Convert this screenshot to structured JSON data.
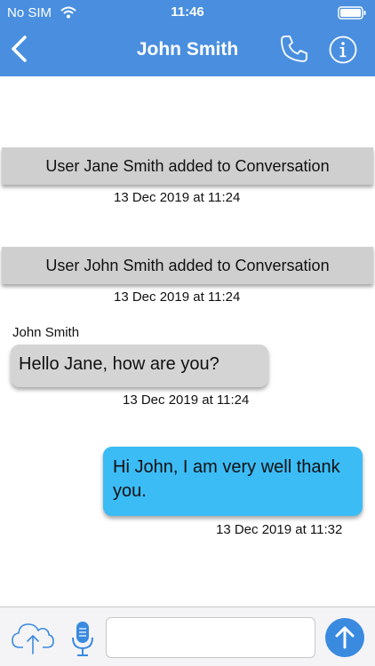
{
  "status_bar": {
    "carrier": "No SIM",
    "time": "11:46"
  },
  "nav": {
    "title": "John Smith",
    "back_icon": "chevron-left-icon",
    "phone_icon": "phone-icon",
    "info_icon": "info-icon"
  },
  "messages": {
    "system": [
      {
        "text": "User Jane Smith added to Conversation",
        "timestamp": "13 Dec 2019 at 11:24"
      },
      {
        "text": "User John Smith added to Conversation",
        "timestamp": "13 Dec 2019 at 11:24"
      }
    ],
    "incoming": {
      "sender": "John Smith",
      "text": "Hello Jane, how are you?",
      "timestamp": "13 Dec 2019 at 11:24"
    },
    "outgoing": {
      "text": "Hi John, I am very well thank you.",
      "timestamp": "13 Dec 2019 at 11:32"
    }
  },
  "composer": {
    "placeholder": "",
    "upload_icon": "cloud-upload-icon",
    "mic_icon": "microphone-icon",
    "send_icon": "arrow-up-icon"
  },
  "colors": {
    "header": "#4a8fdf",
    "system_message_bg": "#cfcfcf",
    "incoming_bubble": "#d4d4d4",
    "outgoing_bubble": "#3bbcf5",
    "send_button": "#3a8ae0"
  }
}
